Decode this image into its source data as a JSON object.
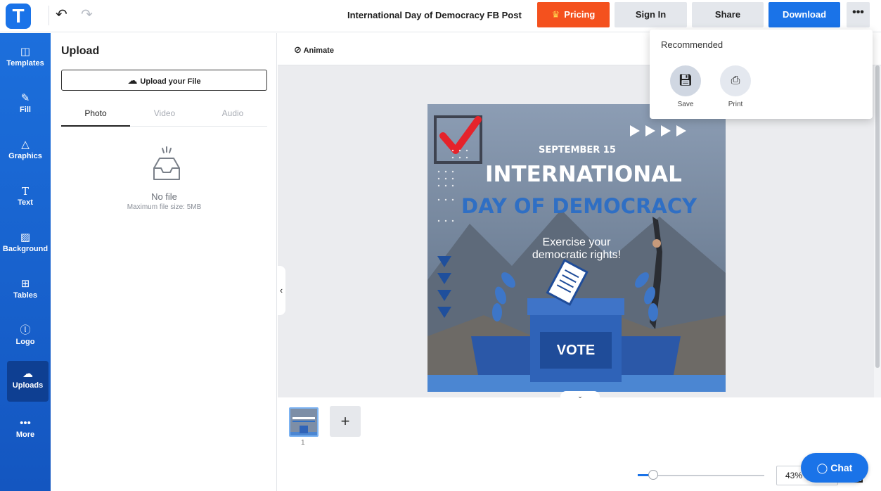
{
  "app": {
    "logo_letter": "T",
    "document_title": "International Day of Democracy FB Post"
  },
  "header": {
    "pricing_label": "Pricing",
    "signin_label": "Sign In",
    "share_label": "Share",
    "download_label": "Download",
    "more_label": "•••"
  },
  "sidebar": {
    "items": [
      {
        "label": "Templates",
        "icon": "templates-icon"
      },
      {
        "label": "Fill",
        "icon": "pencil-icon"
      },
      {
        "label": "Graphics",
        "icon": "shapes-icon"
      },
      {
        "label": "Text",
        "icon": "text-icon"
      },
      {
        "label": "Background",
        "icon": "background-icon"
      },
      {
        "label": "Tables",
        "icon": "table-icon"
      },
      {
        "label": "Logo",
        "icon": "logo-icon"
      },
      {
        "label": "Uploads",
        "icon": "cloud-upload-icon"
      },
      {
        "label": "More",
        "icon": "dots-icon"
      }
    ],
    "active": "Uploads"
  },
  "panel": {
    "title": "Upload",
    "upload_button": "Upload your File",
    "tabs": [
      "Photo",
      "Video",
      "Audio"
    ],
    "active_tab": "Photo",
    "empty_title": "No file",
    "empty_subtitle": "Maximum file size: 5MB"
  },
  "toolbar": {
    "animate_label": "Animate"
  },
  "poster": {
    "date": "SEPTEMBER 15",
    "headline_1": "INTERNATIONAL",
    "headline_2": "DAY OF DEMOCRACY",
    "tagline_1": "Exercise your",
    "tagline_2": "democratic rights!",
    "ballot_label": "VOTE",
    "colors": {
      "accent_blue": "#2f6fc4",
      "check_red": "#e5232b",
      "sky": "#7f93ad"
    }
  },
  "pages": {
    "current_page": "1",
    "add_page_label": "+"
  },
  "zoom": {
    "value": "43%",
    "level": 0.1
  },
  "chat": {
    "label": "Chat"
  },
  "download_menu": {
    "title": "Recommended",
    "items": [
      {
        "label": "Save",
        "icon": "save-icon"
      },
      {
        "label": "Print",
        "icon": "print-icon"
      }
    ]
  }
}
